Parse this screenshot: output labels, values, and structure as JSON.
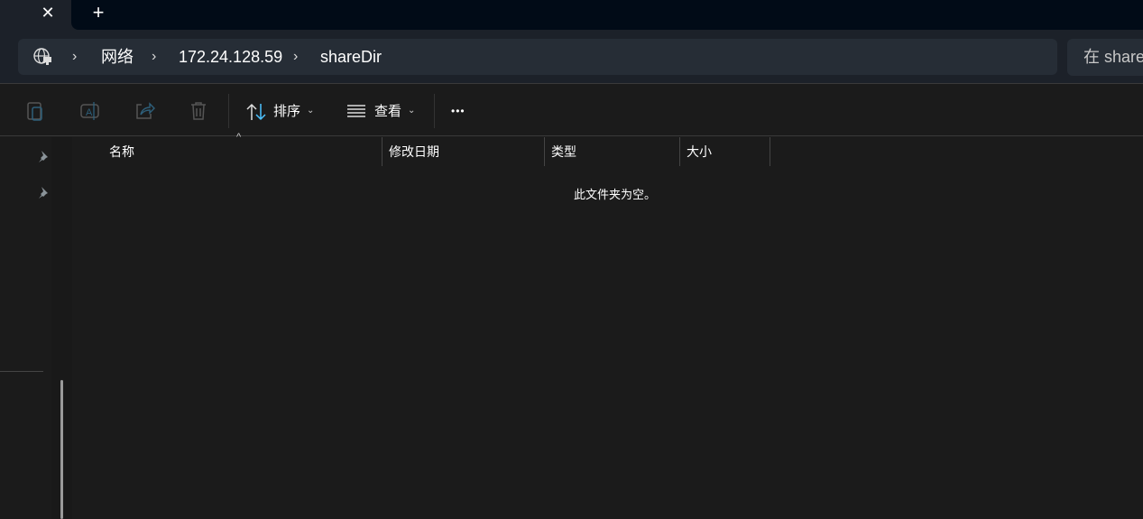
{
  "tabs": {
    "close_glyph": "✕",
    "new_tab_glyph": "+"
  },
  "breadcrumb": [
    "网络",
    "172.24.128.59",
    "shareDir"
  ],
  "search": {
    "placeholder": "在 shareDir 中搜索"
  },
  "toolbar": {
    "sort_label": "排序",
    "view_label": "查看",
    "more_glyph": "•••"
  },
  "columns": [
    "名称",
    "修改日期",
    "类型",
    "大小"
  ],
  "empty_message": "此文件夹为空。",
  "colors": {
    "accent": "#4cc2ff",
    "background": "#1b1b1b",
    "address_bar": "#262d36"
  }
}
